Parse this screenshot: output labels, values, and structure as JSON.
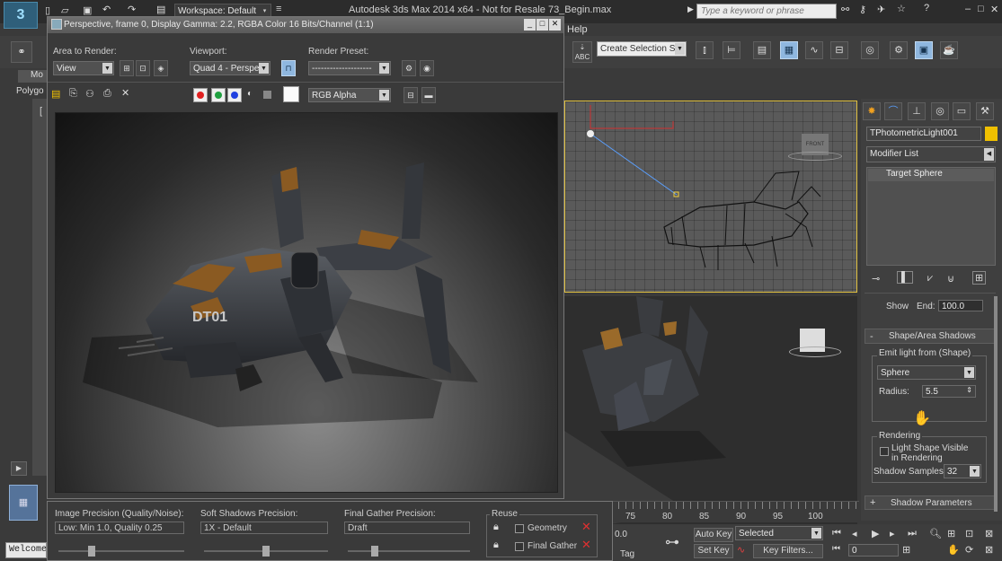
{
  "app": {
    "title": "Autodesk 3ds Max  2014 x64   - Not for Resale   73_Begin.max",
    "workspace": "Workspace: Default",
    "search_placeholder": "Type a keyword or phrase",
    "menu_help": "Help",
    "win_controls": [
      "–",
      "□",
      "✕"
    ]
  },
  "toolbar": {
    "selection_set": "Create Selection Se",
    "abc_label": "ABC"
  },
  "left_panel": {
    "tab_label": "Mo",
    "polygon_label": "Polygo",
    "bracket": "["
  },
  "render_window": {
    "title": "Perspective, frame 0, Display Gamma: 2.2, RGBA Color 16 Bits/Channel (1:1)",
    "area_label": "Area to Render:",
    "area_value": "View",
    "viewport_label": "Viewport:",
    "viewport_value": "Quad 4 - Perspect",
    "preset_label": "Render Preset:",
    "preset_value": "--------------------",
    "channel_value": "RGB Alpha",
    "controls": [
      "_",
      "□",
      "✕"
    ],
    "decal": "DT01",
    "channel_colors": {
      "red": "#e02020",
      "green": "#20a040",
      "blue": "#2040e0"
    }
  },
  "bottom_panel": {
    "image_precision_label": "Image Precision (Quality/Noise):",
    "image_precision_value": "Low: Min 1.0, Quality 0.25",
    "image_precision_level": 0.25,
    "soft_shadows_label": "Soft Shadows Precision:",
    "soft_shadows_value": "1X - Default",
    "soft_shadows_level": 0.5,
    "final_gather_label": "Final Gather Precision:",
    "final_gather_value": "Draft",
    "final_gather_level": 0.2,
    "reuse_label": "Reuse",
    "geometry_label": "Geometry",
    "final_gather_reuse_label": "Final Gather"
  },
  "timeline": {
    "ticks": [
      "75",
      "80",
      "85",
      "90",
      "95",
      "100"
    ],
    "frame_value": "0.0",
    "add_tag": "Tag"
  },
  "anim": {
    "auto_key": "Auto Key",
    "set_key": "Set Key",
    "selected": "Selected",
    "key_filters": "Key Filters...",
    "frame": "0"
  },
  "status": {
    "welcome": "Welcome"
  },
  "command_panel": {
    "object_name": "TPhotometricLight001",
    "object_color": "#f0c000",
    "modifier_list": "Modifier List",
    "stack_item": "Target Sphere",
    "show_label": "Show",
    "end_label": "End:",
    "end_value": "100.0",
    "rollout_shape": "Shape/Area Shadows",
    "emit_label": "Emit light from (Shape)",
    "shape_value": "Sphere",
    "radius_label": "Radius:",
    "radius_value": "5.5",
    "rendering_label": "Rendering",
    "light_visible_label": "Light Shape Visible in Rendering",
    "shadow_samples_label": "Shadow Samples:",
    "shadow_samples_value": "32",
    "rollout_shadow_params": "Shadow Parameters",
    "minus": "-",
    "plus": "+"
  },
  "viewports": {
    "cube_label": "FRONT"
  }
}
